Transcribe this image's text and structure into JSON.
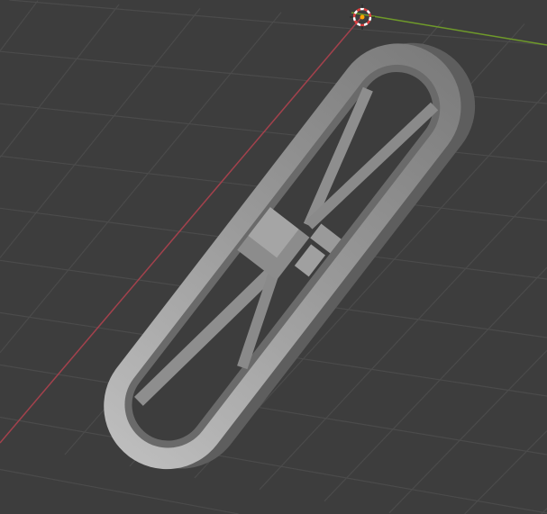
{
  "viewport": {
    "background": "#3d3d3d",
    "grid_color": "#4b4b4b",
    "x_axis_color": "#a3414c",
    "y_axis_color": "#6f9a2a"
  },
  "object": {
    "base_color": "#9a9a9a",
    "shadow_color": "#5e5e5e",
    "highlight_color": "#c8c8c8"
  },
  "cursor": {
    "ring_red": "#e04040",
    "ring_white": "#ffffff",
    "origin": "#ffa500"
  }
}
